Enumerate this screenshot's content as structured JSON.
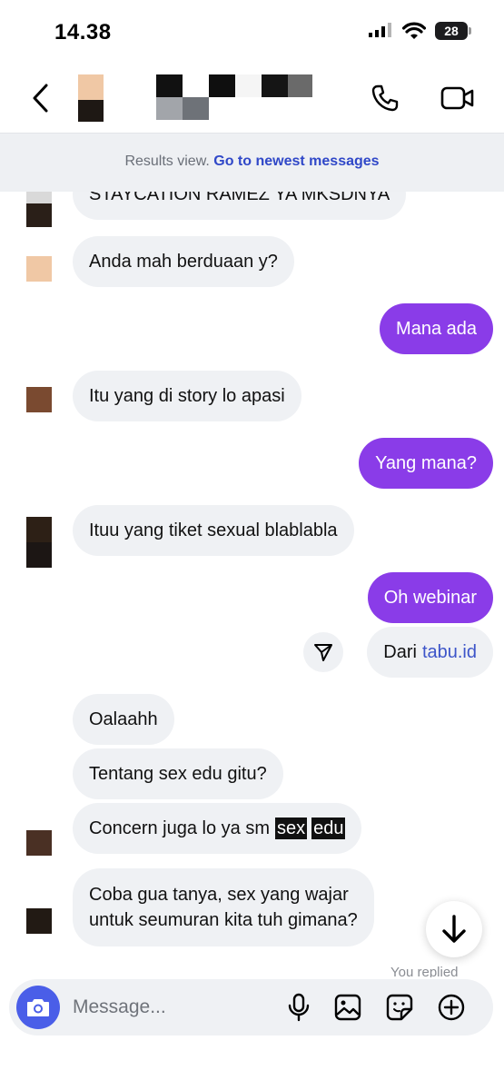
{
  "status_bar": {
    "time": "14.38",
    "battery": "28"
  },
  "header": {
    "back_icon": "chevron-left-icon",
    "call_icon": "phone-icon",
    "video_icon": "video-camera-icon"
  },
  "results_bar": {
    "text": "Results view.",
    "link": "Go to newest messages"
  },
  "messages": [
    {
      "from": "them",
      "text": "STAYCATION RAMEZ YA MKSDNYA"
    },
    {
      "from": "them",
      "text": "Anda mah berduaan y?"
    },
    {
      "from": "me",
      "text": "Mana ada"
    },
    {
      "from": "them",
      "text": "Itu yang di story lo apasi"
    },
    {
      "from": "me",
      "text": "Yang mana?"
    },
    {
      "from": "them",
      "text": "Ituu yang tiket sexual blablabla"
    },
    {
      "from": "me",
      "text": "Oh webinar"
    },
    {
      "from": "me",
      "text_prefix": "Dari",
      "link_text": "tabu.id"
    },
    {
      "from": "them",
      "text": "Oalaahh"
    },
    {
      "from": "them",
      "text": "Tentang sex edu gitu?"
    },
    {
      "from": "them",
      "text": "Concern juga lo ya sm",
      "highlight_1": "sex",
      "highlight_2": "edu"
    },
    {
      "from": "them",
      "line1": "Coba gua tanya, sex yang wajar",
      "line2": "untuk seumuran kita tuh gimana?"
    }
  ],
  "you_replied": "You replied",
  "composer": {
    "placeholder": "Message...",
    "icons": [
      "camera-icon",
      "microphone-icon",
      "image-icon",
      "sticker-icon",
      "plus-circle-icon"
    ]
  },
  "colors": {
    "outgoing_bubble": "#8a3ce8",
    "incoming_bubble": "#eff1f4",
    "link": "#3048c8",
    "camera_button": "#4a5ee8"
  }
}
